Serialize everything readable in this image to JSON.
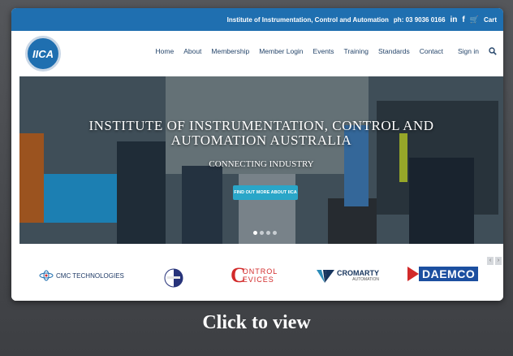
{
  "topbar": {
    "institute": "Institute of Instrumentation, Control and Automation",
    "phone": "ph: 03 9036 0166",
    "linkedin": "in",
    "facebook": "f",
    "cart": "Cart"
  },
  "logo": {
    "text": "IICA"
  },
  "nav": {
    "items": [
      "Home",
      "About",
      "Membership",
      "Member Login",
      "Events",
      "Training",
      "Standards",
      "Contact"
    ],
    "signin": "Sign in"
  },
  "hero": {
    "title_line1": "INSTITUTE OF INSTRUMENTATION, CONTROL AND",
    "title_line2": "AUTOMATION AUSTRALIA",
    "subtitle": "CONNECTING INDUSTRY",
    "button": "FIND OUT MORE ABOUT IICA"
  },
  "partners": {
    "cmc": "CMC TECHNOLOGIES",
    "control_devices_1": "ONTROL",
    "control_devices_2": "EVICES",
    "cromarty": "CROMARTY",
    "cromarty_sub": "AUTOMATION",
    "daemco": "DAEMCO"
  },
  "caption": "Click to view",
  "colors": {
    "brand_blue": "#1f6fb0",
    "button_teal": "#2aa6c8",
    "nav_text": "#26466b",
    "daemco_blue": "#1c4fa0",
    "control_red": "#d22a2a"
  }
}
